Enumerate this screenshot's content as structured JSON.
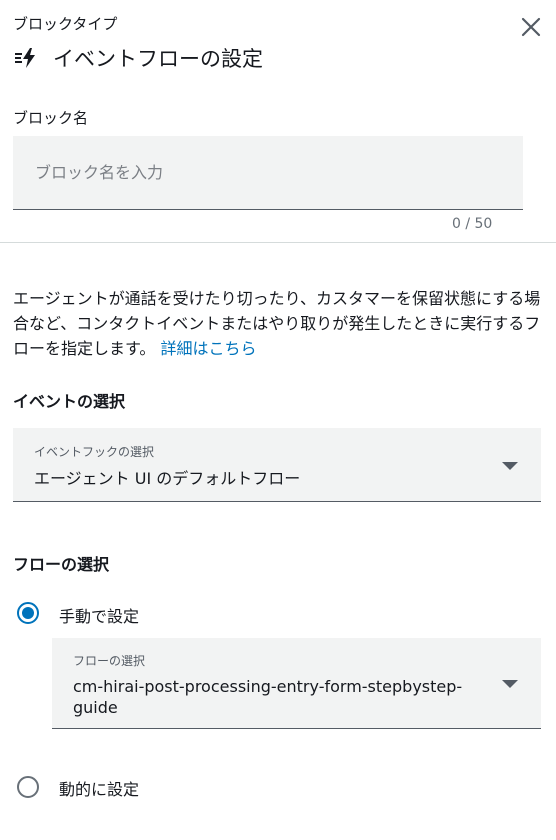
{
  "header": {
    "block_type_label": "ブロックタイプ",
    "title": "イベントフローの設定",
    "title_icon": "event-flow-icon",
    "close_icon": "close-icon"
  },
  "block_name": {
    "label": "ブロック名",
    "value": "",
    "placeholder": "ブロック名を入力",
    "char_count": "0 / 50"
  },
  "description": {
    "text": "エージェントが通話を受けたり切ったり、カスタマーを保留状態にする場合など、コンタクトイベントまたはやり取りが発生したときに実行するフローを指定します。",
    "link_text": "詳細はこちら"
  },
  "event_selection": {
    "heading": "イベントの選択",
    "select_caption": "イベントフックの選択",
    "select_value": "エージェント UI のデフォルトフロー"
  },
  "flow_selection": {
    "heading": "フローの選択",
    "options": [
      {
        "label": "手動で設定",
        "checked": true
      },
      {
        "label": "動的に設定",
        "checked": false
      }
    ],
    "select_caption": "フローの選択",
    "select_value": "cm-hirai-post-processing-entry-form-stepbystep-guide"
  },
  "colors": {
    "accent": "#0073bb",
    "text": "#16191f",
    "field_bg": "#f2f3f3"
  }
}
